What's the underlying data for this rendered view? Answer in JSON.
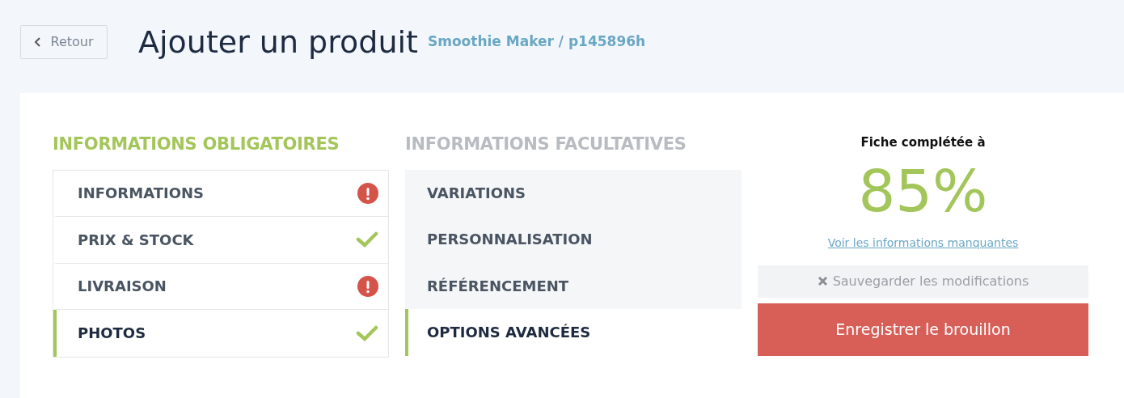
{
  "header": {
    "back_button": "Retour",
    "title": "Ajouter un produit",
    "subtitle": "Smoothie Maker / p145896h"
  },
  "required_section": {
    "heading": "INFORMATIONS OBLIGATOIRES",
    "items": [
      {
        "label": "INFORMATIONS",
        "complete": false,
        "selected": false
      },
      {
        "label": "PRIX & STOCK",
        "complete": true,
        "selected": false
      },
      {
        "label": "LIVRAISON",
        "complete": false,
        "selected": false
      },
      {
        "label": "PHOTOS",
        "complete": true,
        "selected": true
      }
    ]
  },
  "optional_section": {
    "heading": "INFORMATIONS FACULTATIVES",
    "items": [
      {
        "label": "VARIATIONS",
        "selected": false
      },
      {
        "label": "PERSONNALISATION",
        "selected": false
      },
      {
        "label": "RÉFÉRENCEMENT",
        "selected": false
      },
      {
        "label": "OPTIONS AVANCÉES",
        "selected": true
      }
    ]
  },
  "completion": {
    "label": "Fiche complétée à",
    "percent": "85%",
    "link": "Voir les informations manquantes",
    "save_button": {
      "label": "Sauvegarder les modifications",
      "disabled": true
    },
    "draft_button": "Enregistrer le brouillon"
  }
}
